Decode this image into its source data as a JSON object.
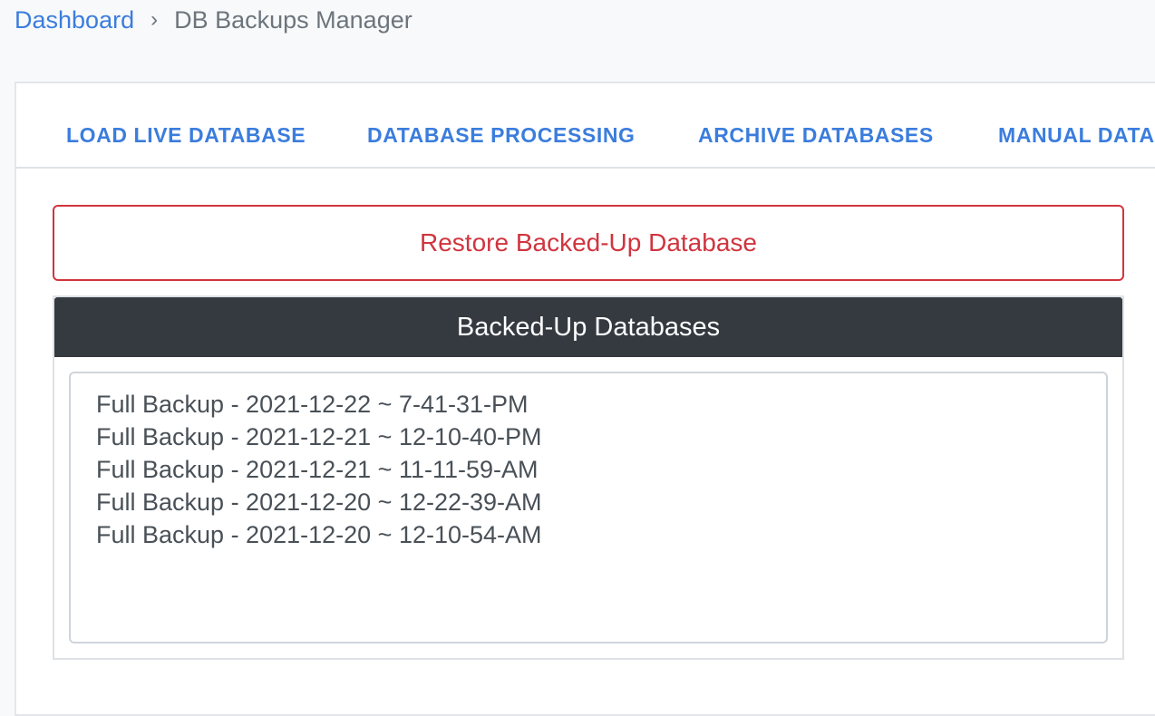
{
  "breadcrumb": {
    "home_label": "Dashboard",
    "separator": "›",
    "current_label": "DB Backups Manager"
  },
  "tabs": [
    {
      "label": "LOAD LIVE DATABASE"
    },
    {
      "label": "DATABASE PROCESSING"
    },
    {
      "label": "ARCHIVE DATABASES"
    },
    {
      "label": "MANUAL DATA"
    }
  ],
  "restore": {
    "button_label": "Restore Backed-Up Database"
  },
  "backups": {
    "header": "Backed-Up Databases",
    "items": [
      {
        "label": "Full Backup - 2021-12-22 ~ 7-41-31-PM"
      },
      {
        "label": "Full Backup - 2021-12-21 ~ 12-10-40-PM"
      },
      {
        "label": "Full Backup - 2021-12-21 ~ 11-11-59-AM"
      },
      {
        "label": "Full Backup - 2021-12-20 ~ 12-22-39-AM"
      },
      {
        "label": "Full Backup - 2021-12-20 ~ 12-10-54-AM"
      }
    ]
  },
  "colors": {
    "link": "#3b7ddd",
    "danger": "#d0353f",
    "header_bg": "#343a40"
  }
}
